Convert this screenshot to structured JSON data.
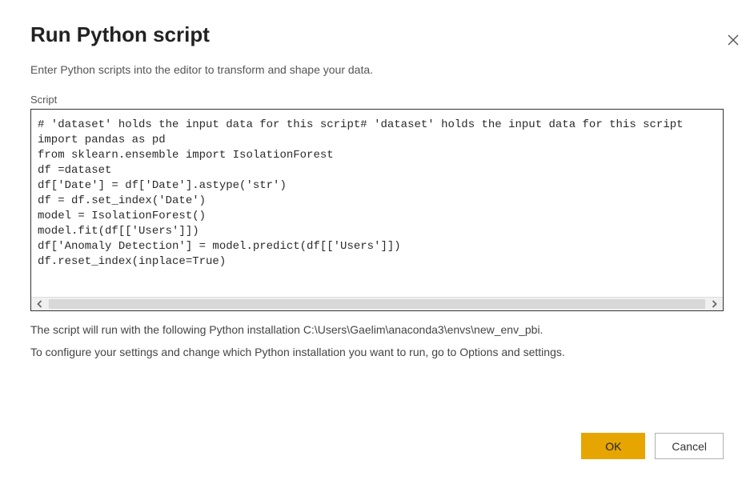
{
  "dialog": {
    "title": "Run Python script",
    "subtitle": "Enter Python scripts into the editor to transform and shape your data.",
    "script_label": "Script",
    "script_content": "# 'dataset' holds the input data for this script# 'dataset' holds the input data for this script\nimport pandas as pd\nfrom sklearn.ensemble import IsolationForest\ndf =dataset\ndf['Date'] = df['Date'].astype('str')\ndf = df.set_index('Date')\nmodel = IsolationForest()\nmodel.fit(df[['Users']])\ndf['Anomaly Detection'] = model.predict(df[['Users']])\ndf.reset_index(inplace=True)",
    "info_line1": "The script will run with the following Python installation C:\\Users\\Gaelim\\anaconda3\\envs\\new_env_pbi.",
    "info_line2": "To configure your settings and change which Python installation you want to run, go to Options and settings.",
    "ok_label": "OK",
    "cancel_label": "Cancel"
  },
  "colors": {
    "accent": "#e6a500"
  }
}
